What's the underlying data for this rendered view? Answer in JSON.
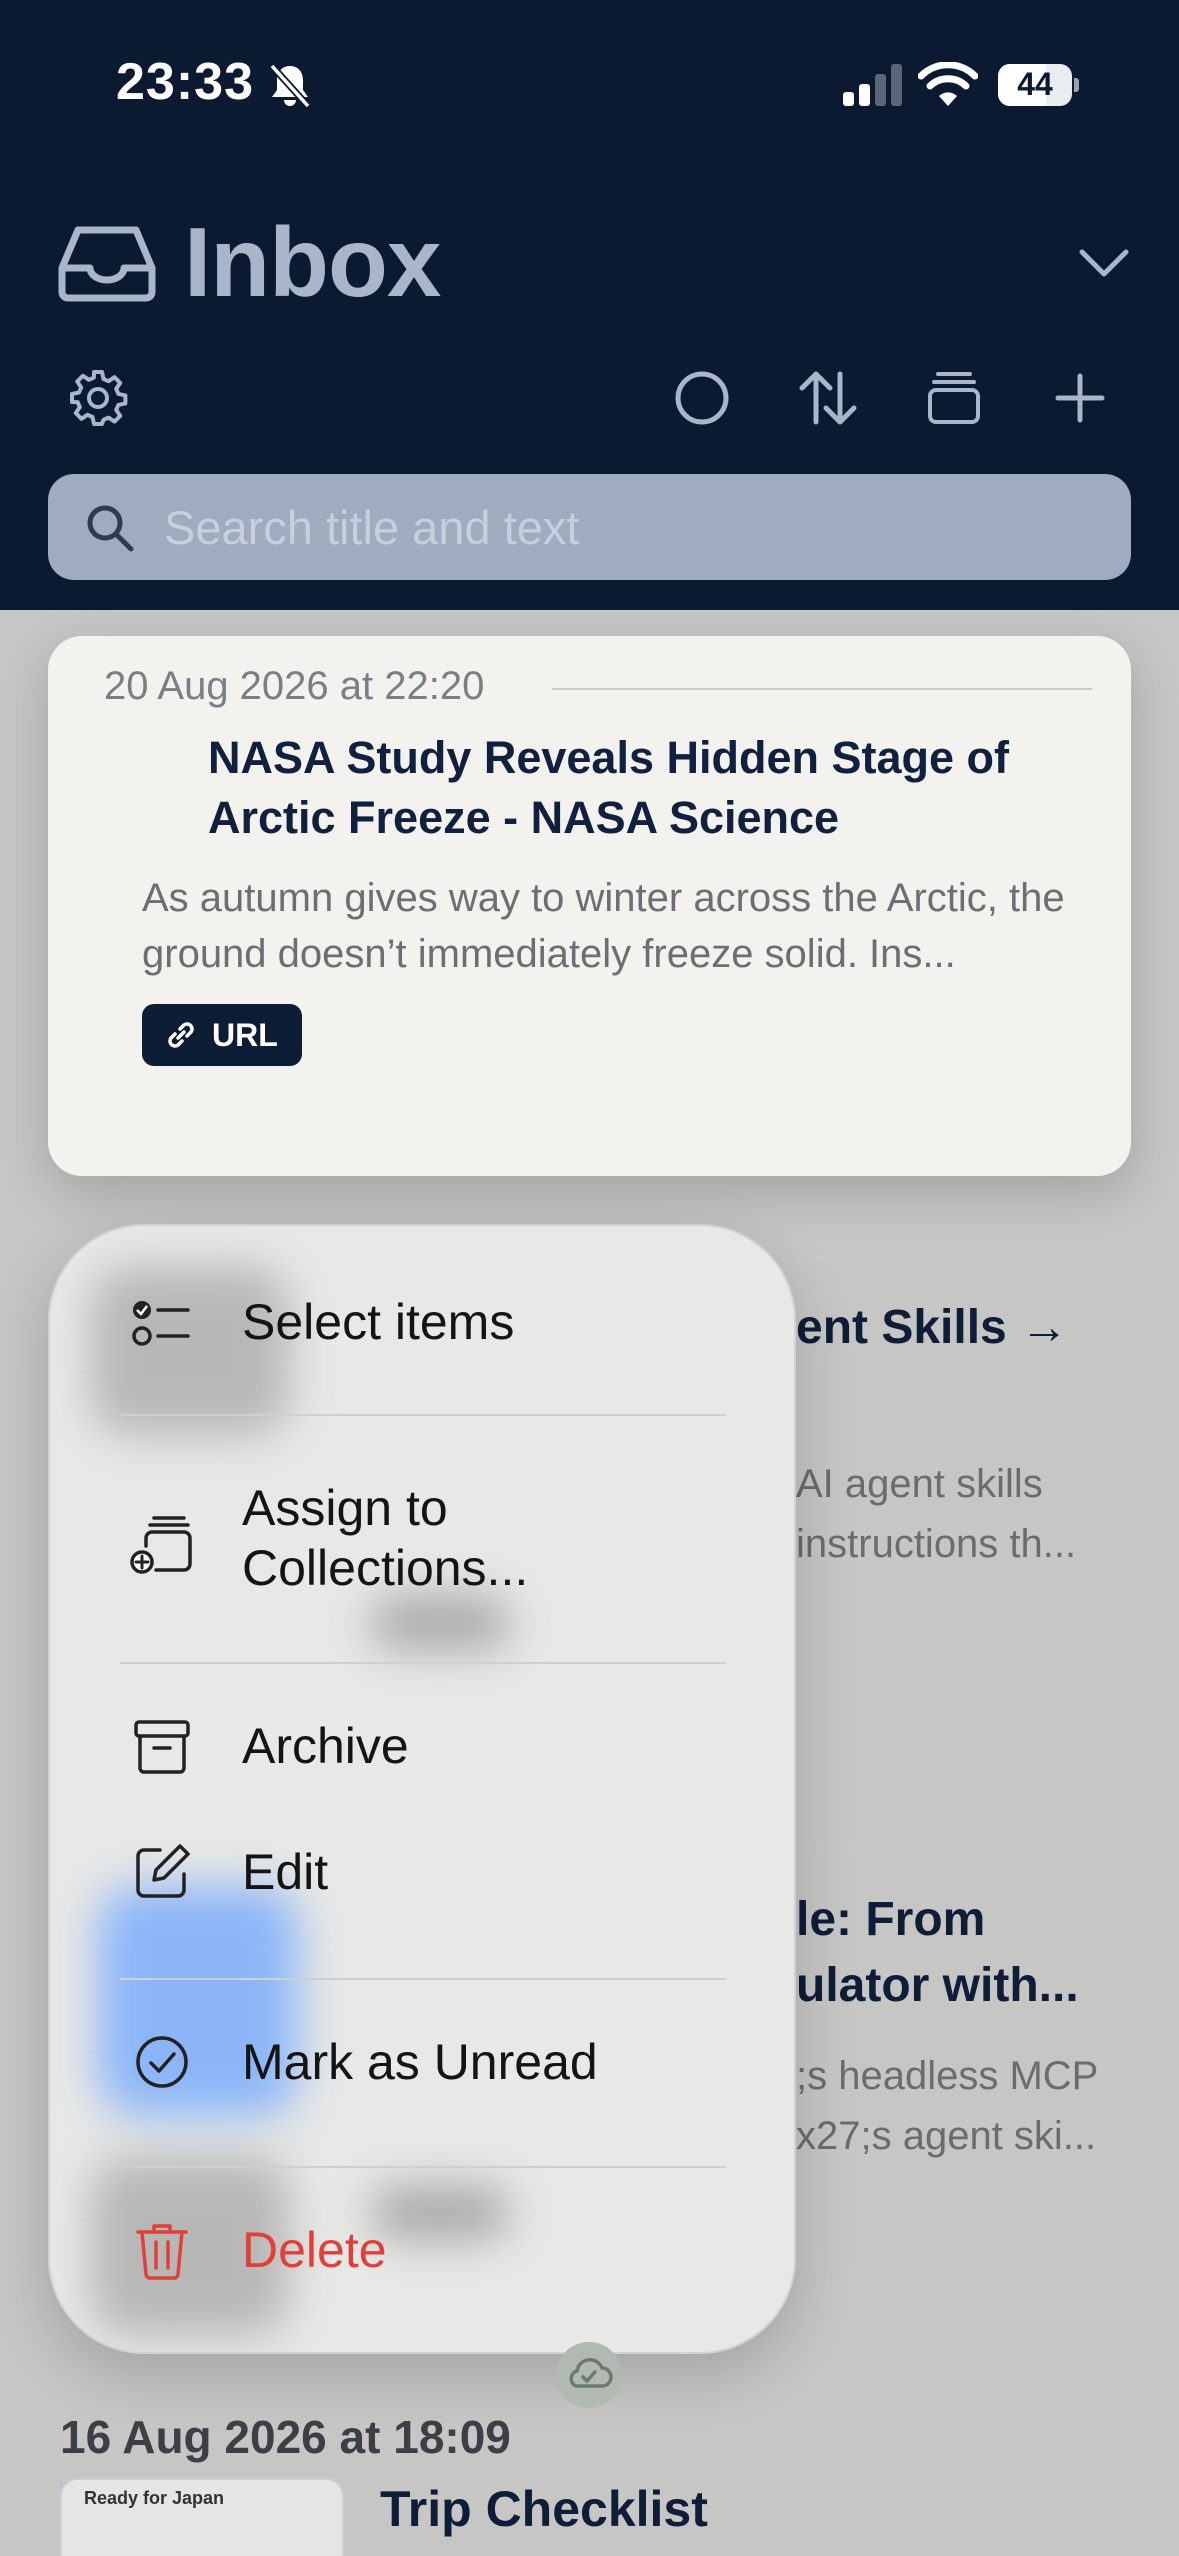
{
  "status_bar": {
    "time": "23:33",
    "battery": "44"
  },
  "header": {
    "title": "Inbox",
    "search_placeholder": "Search title and text"
  },
  "icons": [
    "bell-slash-icon",
    "signal-icon",
    "wifi-icon",
    "battery-icon",
    "inbox-tray-icon",
    "chevron-down-icon",
    "gear-icon",
    "circle-icon",
    "sort-arrows-icon",
    "collections-icon",
    "plus-icon",
    "search-icon",
    "link-icon",
    "select-list-icon",
    "assign-collections-icon",
    "archive-icon",
    "edit-icon",
    "checkmark-circle-icon",
    "trash-icon",
    "cloud-check-icon"
  ],
  "cards": {
    "top": {
      "date": "20 Aug 2026 at 22:20",
      "title": "NASA Study Reveals Hidden Stage of Arctic Freeze - NASA Science",
      "excerpt": "As autumn gives way to winter across the Arctic, the ground doesn’t immediately freeze solid. Ins...",
      "badge": "URL"
    },
    "obscured": [
      {
        "title_fragment": "ent Skills →",
        "excerpt_line1": "AI agent skills",
        "excerpt_line2": "instructions th..."
      },
      {
        "title_line1": "le: From",
        "title_line2": "ulator with...",
        "excerpt_line1": ";s headless MCP",
        "excerpt_line2": "x27;s agent ski..."
      }
    ],
    "bottom": {
      "date": "16 Aug 2026 at 18:09",
      "title": "Trip Checklist",
      "thumb_text": "Ready for Japan"
    }
  },
  "menu": {
    "select_items": "Select items",
    "assign_line1": "Assign to",
    "assign_line2": "Collections...",
    "archive": "Archive",
    "edit": "Edit",
    "mark_unread": "Mark as Unread",
    "delete": "Delete"
  },
  "colors": {
    "header_bg": "#0c1a31",
    "badge_bg": "#0e1d36",
    "delete_red": "#e0403a",
    "blur_blue": "#8bb5f8"
  }
}
